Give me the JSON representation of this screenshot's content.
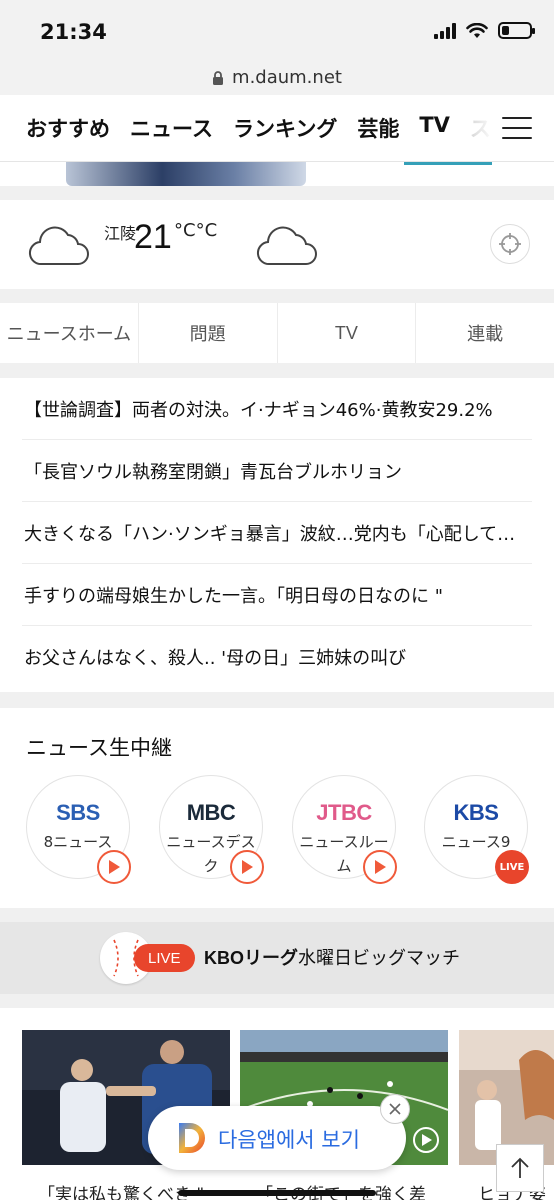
{
  "status_bar": {
    "time": "21:34",
    "battery_level": 0.25
  },
  "url_bar": {
    "url": "m.daum.net"
  },
  "nav": {
    "tabs": [
      {
        "label": "おすすめ",
        "active": false
      },
      {
        "label": "ニュース",
        "active": true
      },
      {
        "label": "ランキング",
        "active": false
      },
      {
        "label": "芸能",
        "active": false
      },
      {
        "label": "TV",
        "active": false
      },
      {
        "label": "ス",
        "active": false
      }
    ]
  },
  "weather": {
    "city": "江陵",
    "temperature": "21",
    "unit": "°C°C"
  },
  "subtabs": [
    "ニュースホーム",
    "問題",
    "TV",
    "連載"
  ],
  "headlines": [
    "【世論調査】両者の対決。イ·ナギョン46%·黄教安29.2%",
    "「長官ソウル執務室閉鎖」青瓦台ブルホリョン",
    "大きくなる「ハン·ソンギョ暴言」波紋…党内も「心配して…",
    "手すりの端母娘生かした一言。「明日母の日なのに \"",
    "お父さんはなく、殺人.. '母の日」三姉妹の叫び"
  ],
  "live": {
    "title": "ニュース生中継",
    "channels": [
      {
        "logo": "SBS",
        "label": "8ニュース",
        "logo_color": "#2b5fb3",
        "badge": "play"
      },
      {
        "logo": "MBC",
        "label": "ニュースデスク",
        "logo_color": "#1b2a3a",
        "badge": "play"
      },
      {
        "logo": "JTBC",
        "label": "ニュースルーム",
        "logo_color": "#e05a8a",
        "badge": "play"
      },
      {
        "logo": "KBS",
        "label": "ニュース9",
        "logo_color": "#1c4aa6",
        "badge": "live",
        "badge_label": "LIVE"
      }
    ]
  },
  "kbo": {
    "live_label": "LIVE",
    "title_bold": "KBOリーグ",
    "title_rest": "水曜日ビッグマッチ"
  },
  "videos": [
    {
      "caption": "「実は私も驚くべき \""
    },
    {
      "caption": "「この街で」を強く差"
    },
    {
      "caption": "ヒョナ姿"
    }
  ],
  "app_banner": {
    "text": "다음앱에서 보기"
  },
  "colors": {
    "accent_red": "#e8452c",
    "app_blue": "#2a6be0",
    "tab_underline": "#111111"
  }
}
